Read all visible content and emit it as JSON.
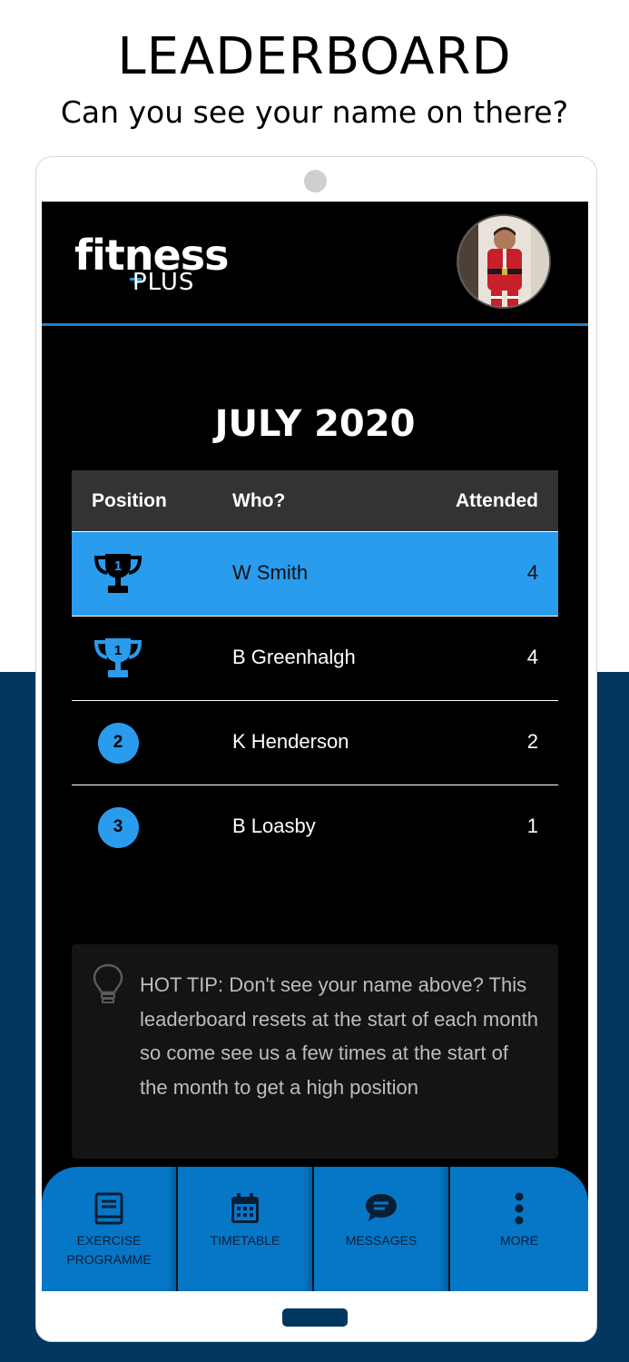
{
  "promo": {
    "title": "LEADERBOARD",
    "subtitle": "Can you see your name on there?"
  },
  "app": {
    "logo_main": "fitness",
    "logo_sub": "PLUS",
    "avatar_icon": "user-photo"
  },
  "leaderboard": {
    "month": "JULY 2020",
    "columns": {
      "position": "Position",
      "who": "Who?",
      "attended": "Attended"
    },
    "rows": [
      {
        "position": "1",
        "icon": "trophy-icon",
        "name": "W Smith",
        "attended": "4",
        "highlighted": true
      },
      {
        "position": "1",
        "icon": "trophy-icon",
        "name": "B Greenhalgh",
        "attended": "4",
        "highlighted": false
      },
      {
        "position": "2",
        "icon": "badge",
        "name": "K Henderson",
        "attended": "2",
        "highlighted": false
      },
      {
        "position": "3",
        "icon": "badge",
        "name": "B Loasby",
        "attended": "1",
        "highlighted": false
      }
    ]
  },
  "tip": {
    "icon": "lightbulb-icon",
    "text": "HOT TIP: Don't see your name above? This leaderboard resets at the start of each month so come see us a few times at the start of the month to get a high position"
  },
  "nav": {
    "items": [
      {
        "label": "EXERCISE PROGRAMME",
        "icon": "book-icon"
      },
      {
        "label": "TIMETABLE",
        "icon": "calendar-icon"
      },
      {
        "label": "MESSAGES",
        "icon": "chat-bubble-icon"
      },
      {
        "label": "MORE",
        "icon": "more-vertical-icon"
      }
    ]
  },
  "colors": {
    "accent": "#299cee",
    "nav_bg": "#0677c7",
    "band": "#02375f",
    "header_border": "#1f7fd0"
  }
}
